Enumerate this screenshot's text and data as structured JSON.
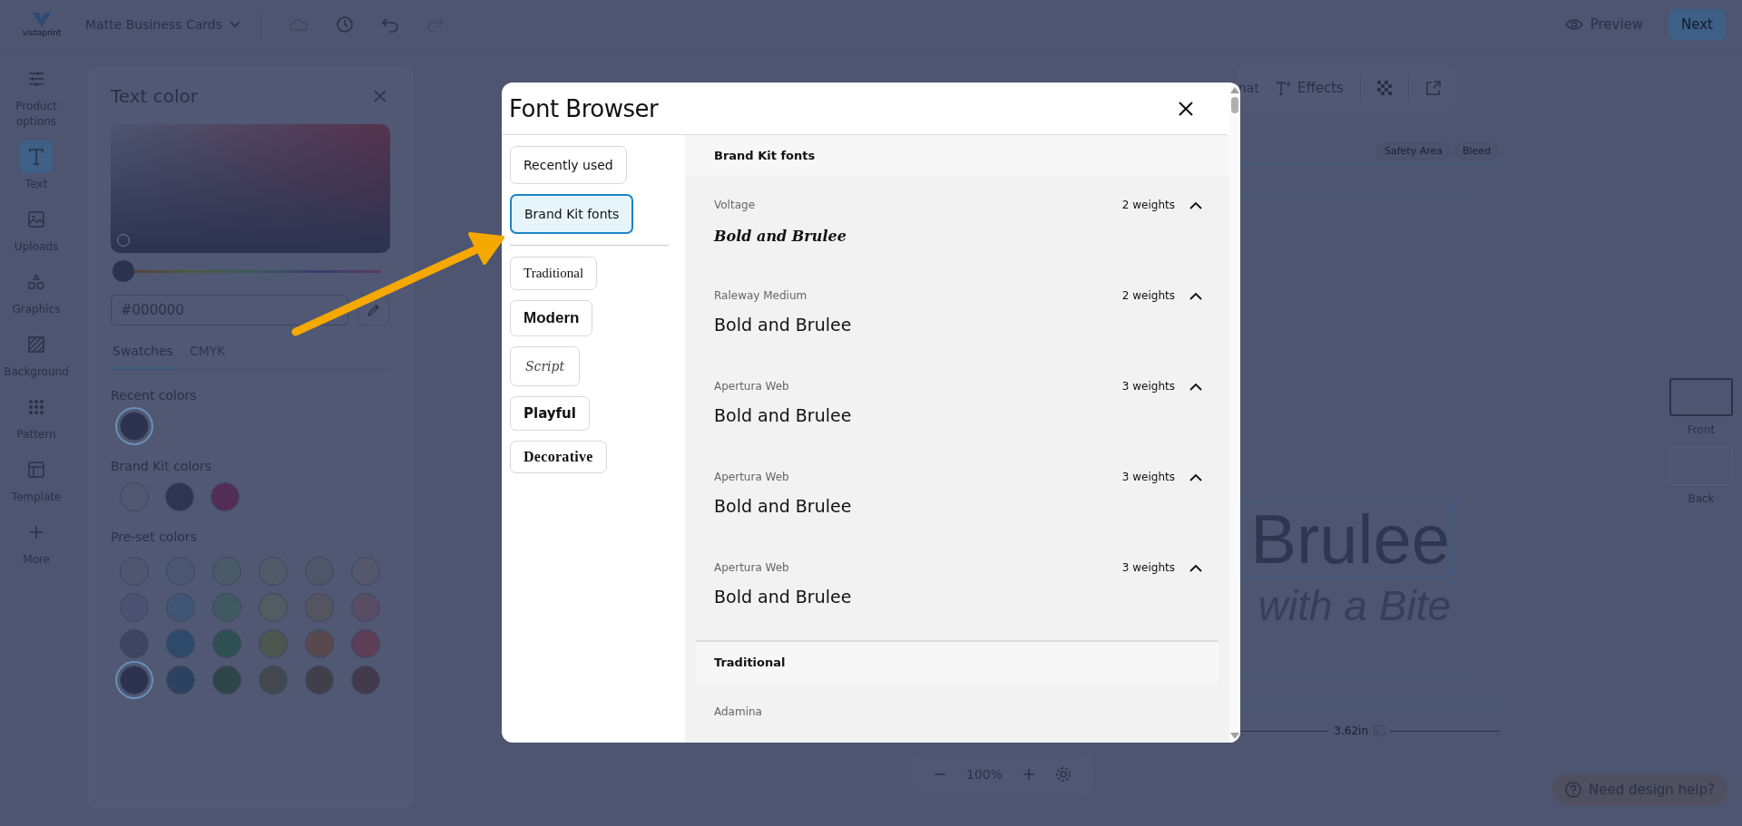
{
  "header": {
    "logo": "vistaprint",
    "document_title": "Matte Business Cards",
    "preview": "Preview",
    "next": "Next"
  },
  "rail": [
    {
      "label": "Product options",
      "selected": false
    },
    {
      "label": "Text",
      "selected": true
    },
    {
      "label": "Uploads",
      "selected": false
    },
    {
      "label": "Graphics",
      "selected": false
    },
    {
      "label": "Background",
      "selected": false
    },
    {
      "label": "Pattern",
      "selected": false
    },
    {
      "label": "Template",
      "selected": false
    },
    {
      "label": "More",
      "selected": false
    }
  ],
  "color_panel": {
    "title": "Text color",
    "hue": {
      "level": 0
    },
    "hex_value": "#000000",
    "tabs": [
      {
        "label": "Swatches",
        "selected": true
      },
      {
        "label": "CMYK",
        "selected": false
      }
    ],
    "recent_label": "Recent colors",
    "recent_colors": [
      {
        "color": "#2b3350",
        "selected": true
      }
    ],
    "brand_label": "Brand Kit colors",
    "brand_colors": [
      {
        "color": "#4f5771",
        "selected": false
      },
      {
        "color": "#2d3550",
        "selected": false
      },
      {
        "color": "#522e56",
        "selected": false
      }
    ],
    "preset_label": "Pre-set colors",
    "preset_colors": [
      {
        "color": "#4e5670",
        "selected": false
      },
      {
        "color": "#4a5672",
        "selected": false
      },
      {
        "color": "#4b5a68",
        "selected": false
      },
      {
        "color": "#525a6a",
        "selected": false
      },
      {
        "color": "#50566a",
        "selected": false
      },
      {
        "color": "#55586d",
        "selected": false
      },
      {
        "color": "#4b5170",
        "selected": false
      },
      {
        "color": "#3f5675",
        "selected": false
      },
      {
        "color": "#415a62",
        "selected": false
      },
      {
        "color": "#535c62",
        "selected": false
      },
      {
        "color": "#55555f",
        "selected": false
      },
      {
        "color": "#594d66",
        "selected": false
      },
      {
        "color": "#3e4462",
        "selected": false
      },
      {
        "color": "#2e4a6a",
        "selected": false
      },
      {
        "color": "#2e5053",
        "selected": false
      },
      {
        "color": "#4e5650",
        "selected": false
      },
      {
        "color": "#58494f",
        "selected": false
      },
      {
        "color": "#5c3f57",
        "selected": false
      },
      {
        "color": "#2b3350",
        "selected": true
      },
      {
        "color": "#2c4260",
        "selected": false
      },
      {
        "color": "#2e4549",
        "selected": false
      },
      {
        "color": "#434850",
        "selected": false
      },
      {
        "color": "#41404a",
        "selected": false
      },
      {
        "color": "#433a4c",
        "selected": false
      }
    ]
  },
  "toolbar": {
    "items": [
      "nat",
      "Effects"
    ]
  },
  "canvas": {
    "badges": [
      "Safety Area",
      "Bleed"
    ],
    "lines": [
      "Brulee",
      "with a Bite"
    ],
    "ruler": "3.62in",
    "zoom": "100%"
  },
  "pages": [
    {
      "label": "Front",
      "selected": true
    },
    {
      "label": "Back",
      "selected": false
    }
  ],
  "help_button": "Need design help?",
  "font_browser": {
    "title": "Font Browser",
    "categories": [
      {
        "label": "Recently used",
        "selected": false
      },
      {
        "label": "Brand Kit fonts",
        "selected": true
      }
    ],
    "style_categories": [
      {
        "label": "Traditional",
        "kind": "serif",
        "selected": false
      },
      {
        "label": "Modern",
        "kind": "bold",
        "selected": false
      },
      {
        "label": "Script",
        "kind": "script",
        "selected": false
      },
      {
        "label": "Playful",
        "kind": "rounded",
        "selected": false
      },
      {
        "label": "Decorative",
        "kind": "display",
        "selected": false
      }
    ],
    "sections": [
      {
        "title": "Brand Kit fonts",
        "fonts": [
          {
            "name": "Voltage",
            "weights": "2 weights",
            "expanded": true,
            "sample": "Bold and Brulee",
            "kind": "script"
          },
          {
            "name": "Raleway Medium",
            "weights": "2 weights",
            "expanded": true,
            "sample": "Bold and Brulee",
            "kind": "sans"
          },
          {
            "name": "Apertura Web",
            "weights": "3 weights",
            "expanded": true,
            "sample": "Bold and Brulee",
            "kind": "sans"
          },
          {
            "name": "Apertura Web",
            "weights": "3 weights",
            "expanded": true,
            "sample": "Bold and Brulee",
            "kind": "sans"
          },
          {
            "name": "Apertura Web",
            "weights": "3 weights",
            "expanded": true,
            "sample": "Bold and Brulee",
            "kind": "sans"
          }
        ]
      },
      {
        "title": "Traditional",
        "fonts": [
          {
            "name": "Adamina"
          }
        ]
      }
    ]
  }
}
